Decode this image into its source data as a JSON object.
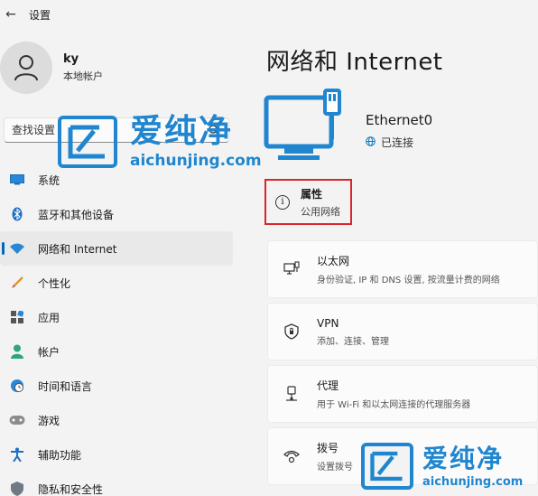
{
  "window": {
    "title": "设置",
    "back_label": "←"
  },
  "profile": {
    "name": "ky",
    "account_type": "本地帐户"
  },
  "search": {
    "placeholder": "查找设置"
  },
  "sidebar": {
    "items": [
      {
        "label": "系统",
        "icon": "monitor-icon"
      },
      {
        "label": "蓝牙和其他设备",
        "icon": "bluetooth-icon"
      },
      {
        "label": "网络和 Internet",
        "icon": "wifi-icon",
        "active": true
      },
      {
        "label": "个性化",
        "icon": "brush-icon"
      },
      {
        "label": "应用",
        "icon": "apps-icon"
      },
      {
        "label": "帐户",
        "icon": "person-icon"
      },
      {
        "label": "时间和语言",
        "icon": "clock-globe-icon"
      },
      {
        "label": "游戏",
        "icon": "gamepad-icon"
      },
      {
        "label": "辅助功能",
        "icon": "accessibility-icon"
      },
      {
        "label": "隐私和安全性",
        "icon": "shield-icon"
      }
    ]
  },
  "main": {
    "title": "网络和 Internet",
    "adapter": {
      "name": "Ethernet0",
      "status": "已连接"
    },
    "properties": {
      "title": "属性",
      "subtitle": "公用网络"
    },
    "cards": [
      {
        "title": "以太网",
        "subtitle": "身份验证, IP 和 DNS 设置, 按流量计费的网络",
        "icon": "ethernet-icon"
      },
      {
        "title": "VPN",
        "subtitle": "添加、连接、管理",
        "icon": "vpn-shield-icon"
      },
      {
        "title": "代理",
        "subtitle": "用于 Wi-Fi 和以太网连接的代理服务器",
        "icon": "proxy-icon"
      },
      {
        "title": "拨号",
        "subtitle": "设置拨号",
        "icon": "dialup-icon"
      }
    ]
  },
  "watermark": {
    "brand": "爱纯净",
    "url": "aichunjing.com"
  },
  "colors": {
    "accent": "#0067c0",
    "highlight_box": "#d9262b",
    "watermark": "#1f86cf",
    "connected_globe": "#0f7bbf"
  }
}
